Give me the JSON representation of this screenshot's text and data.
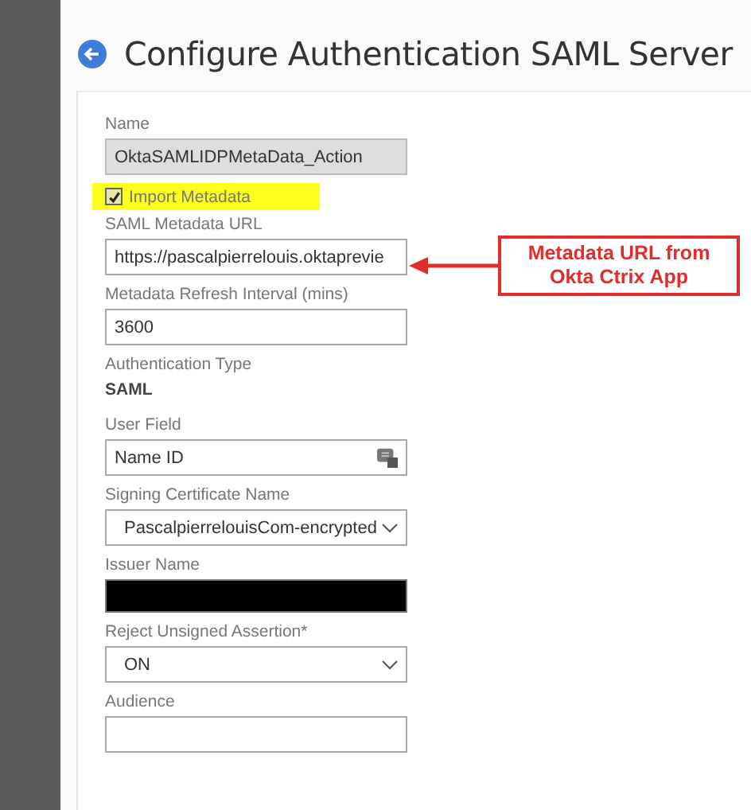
{
  "title": "Configure Authentication SAML Server",
  "fields": [
    {
      "kind": "text",
      "label": "Name",
      "value": "OktaSAMLIDPMetaData_Action",
      "disabled": true
    },
    {
      "kind": "checkbox",
      "label": "Import Metadata",
      "checked": true,
      "highlighted": true
    },
    {
      "kind": "text",
      "label": "SAML Metadata URL",
      "value": "https://pascalpierrelouis.oktaprevie",
      "disabled": false
    },
    {
      "kind": "text",
      "label": "Metadata Refresh Interval (mins)",
      "value": "3600",
      "disabled": false
    },
    {
      "kind": "static",
      "label": "Authentication Type",
      "value": "SAML"
    },
    {
      "kind": "picker",
      "label": "User Field",
      "value": "Name ID"
    },
    {
      "kind": "select",
      "label": "Signing Certificate Name",
      "value": "PascalpierrelouisCom-encrypted"
    },
    {
      "kind": "redacted",
      "label": "Issuer Name"
    },
    {
      "kind": "select",
      "label": "Reject Unsigned Assertion*",
      "value": "ON"
    },
    {
      "kind": "text",
      "label": "Audience",
      "disabled": false
    }
  ],
  "callout": {
    "text": "Metadata URL from Okta Ctrix App"
  }
}
